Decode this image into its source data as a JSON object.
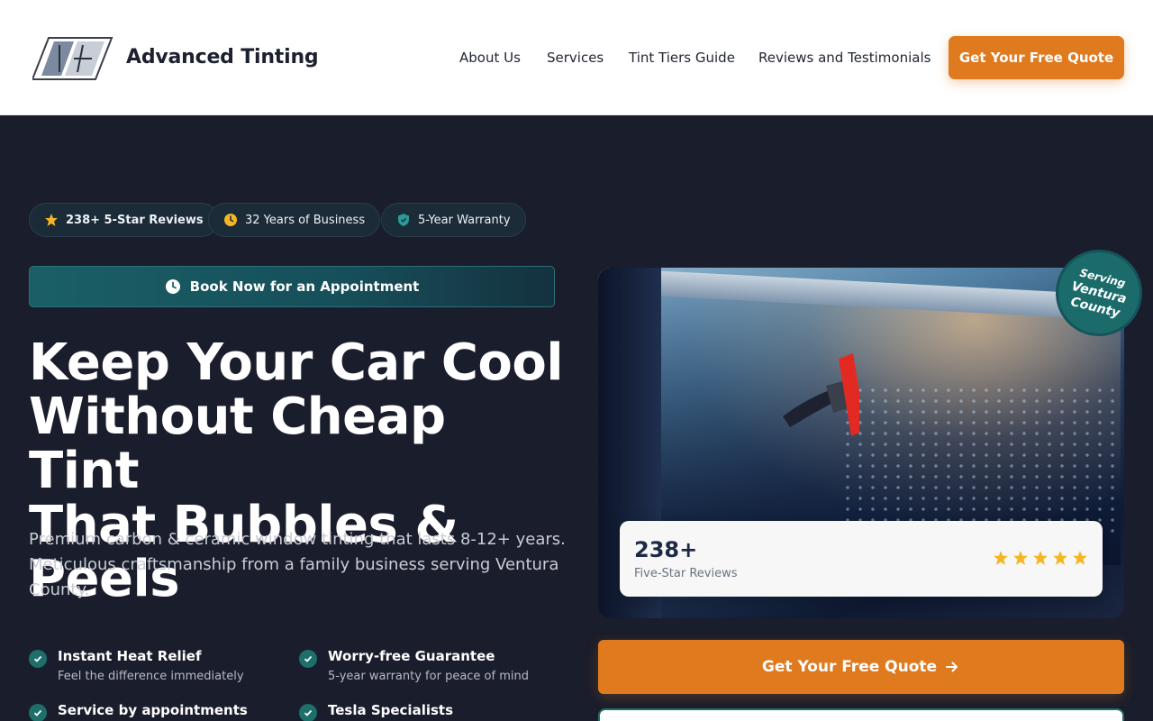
{
  "header": {
    "brand": "Advanced Tinting",
    "nav": [
      "About Us",
      "Services",
      "Tint Tiers Guide",
      "Reviews and Testimonials"
    ],
    "cta": "Get Your Free Quote"
  },
  "hero": {
    "badges": [
      {
        "bold": "238+ 5-Star Reviews",
        "text": "",
        "icon": "star-icon"
      },
      {
        "bold": "",
        "text": "32 Years of Business",
        "icon": "clock-icon"
      },
      {
        "bold": "",
        "text": "5-Year Warranty",
        "icon": "shield-icon"
      }
    ],
    "book_label": "Book Now for an Appointment",
    "headline_lines": [
      "Keep Your Car Cool",
      "Without Cheap Tint",
      "That Bubbles & Peels"
    ],
    "subtitle": "Premium carbon & ceramic window tinting that lasts 8-12+ years. Meticulous craftsmanship from a family business serving Ventura County.",
    "features": [
      {
        "title": "Instant Heat Relief",
        "desc": "Feel the difference immediately"
      },
      {
        "title": "Worry-free Guarantee",
        "desc": "5-year warranty for peace of mind"
      },
      {
        "title": "Service by appointments",
        "desc": ""
      },
      {
        "title": "Tesla Specialists",
        "desc": ""
      }
    ]
  },
  "review_card": {
    "count": "238+",
    "label": "Five-Star Reviews",
    "stars": 5
  },
  "serving_badge": {
    "line1": "Serving",
    "line2": "Ventura",
    "line3": "County"
  },
  "quote_button": {
    "label": "Get Your Free Quote",
    "icon": "arrow-right-icon"
  },
  "colors": {
    "accent": "#e07a1f",
    "teal": "#1b6b6b",
    "background": "#1a1d2b",
    "star": "#f5b524"
  }
}
